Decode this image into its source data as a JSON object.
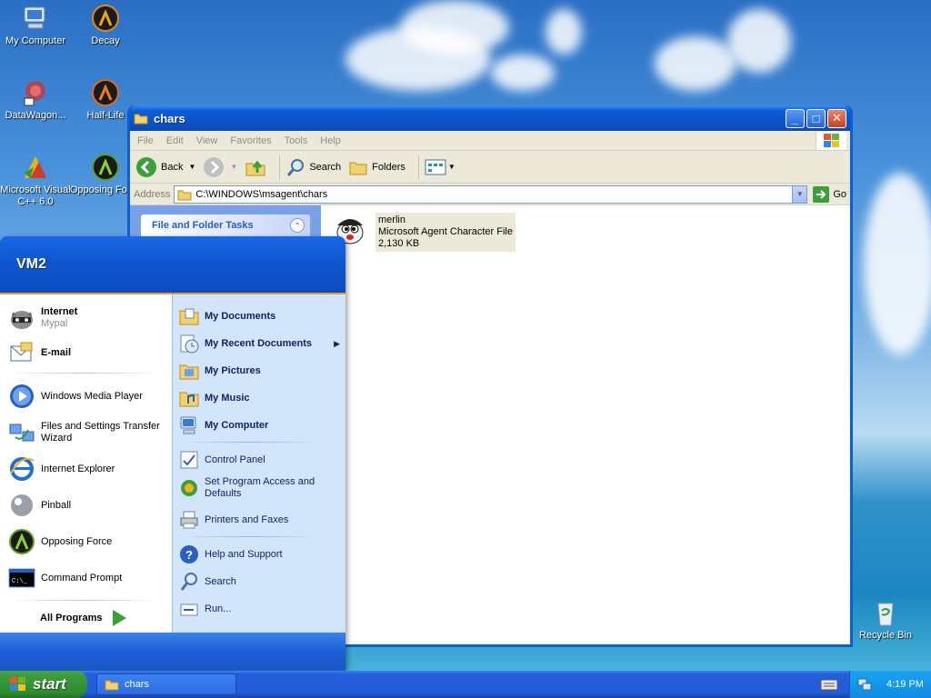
{
  "desktop": {
    "icons": [
      {
        "label": "My Computer"
      },
      {
        "label": "Decay"
      },
      {
        "label": "DataWagon..."
      },
      {
        "label": "Half-Life"
      },
      {
        "label": "Microsoft Visual C++ 6.0"
      },
      {
        "label": "Opposing Force"
      },
      {
        "label": "Recycle Bin"
      }
    ]
  },
  "window": {
    "title": "chars",
    "menu": [
      "File",
      "Edit",
      "View",
      "Favorites",
      "Tools",
      "Help"
    ],
    "toolbar": {
      "back": "Back",
      "search": "Search",
      "folders": "Folders"
    },
    "address": {
      "label": "Address",
      "value": "C:\\WINDOWS\\msagent\\chars",
      "go": "Go"
    },
    "taskpane": {
      "header": "File and Folder Tasks"
    },
    "files": [
      {
        "name": "merlin",
        "type": "Microsoft Agent Character File",
        "size": "2,130 KB"
      }
    ]
  },
  "startmenu": {
    "user": "VM2",
    "pinned": [
      {
        "title": "Internet",
        "subtitle": "Mypal"
      },
      {
        "title": "E-mail"
      }
    ],
    "recent": [
      {
        "label": "Windows Media Player"
      },
      {
        "label": "Files and Settings Transfer Wizard"
      },
      {
        "label": "Internet Explorer"
      },
      {
        "label": "Pinball"
      },
      {
        "label": "Opposing Force"
      },
      {
        "label": "Command Prompt"
      }
    ],
    "all_programs": "All Programs",
    "right": {
      "group1": [
        {
          "label": "My Documents"
        },
        {
          "label": "My Recent Documents"
        },
        {
          "label": "My Pictures"
        },
        {
          "label": "My Music"
        },
        {
          "label": "My Computer"
        }
      ],
      "group2": [
        {
          "label": "Control Panel"
        },
        {
          "label": "Set Program Access and Defaults"
        },
        {
          "label": "Printers and Faxes"
        }
      ],
      "group3": [
        {
          "label": "Help and Support"
        },
        {
          "label": "Search"
        },
        {
          "label": "Run..."
        }
      ]
    }
  },
  "taskbar": {
    "start": "start",
    "tasks": [
      {
        "label": "chars"
      }
    ],
    "clock": "4:19 PM"
  }
}
